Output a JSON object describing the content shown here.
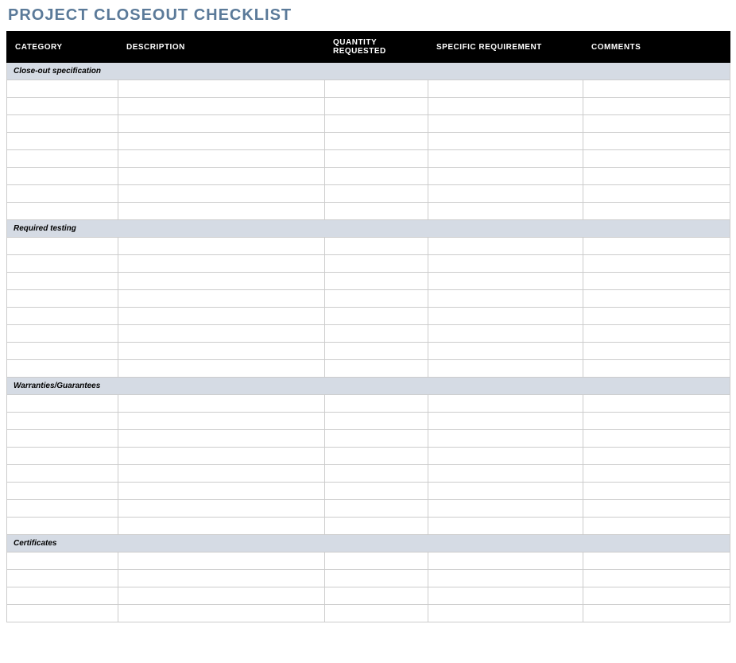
{
  "title": "PROJECT CLOSEOUT CHECKLIST",
  "columns": [
    "CATEGORY",
    "DESCRIPTION",
    "QUANTITY REQUESTED",
    "SPECIFIC REQUIREMENT",
    "COMMENTS"
  ],
  "sections": [
    {
      "label": "Close-out specification",
      "rowCount": 8
    },
    {
      "label": "Required testing",
      "rowCount": 8
    },
    {
      "label": "Warranties/Guarantees",
      "rowCount": 8
    },
    {
      "label": "Certificates",
      "rowCount": 4
    }
  ]
}
